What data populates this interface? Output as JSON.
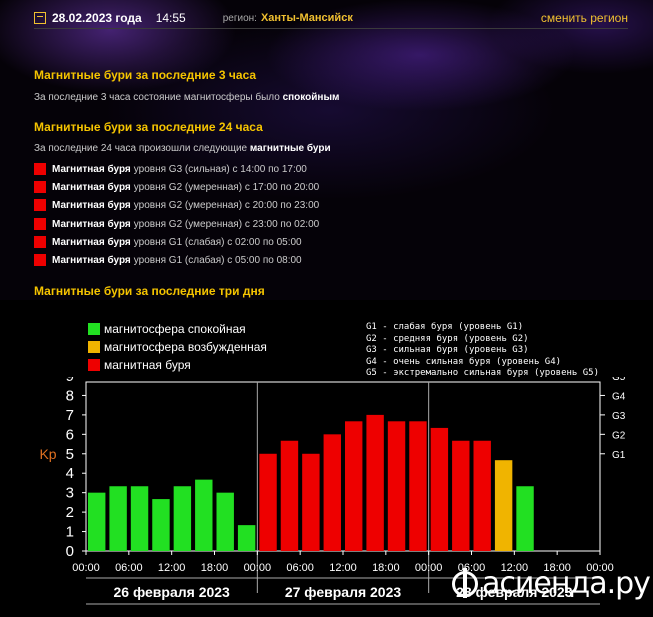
{
  "header": {
    "date": "28.02.2023 года",
    "time": "14:55",
    "region_label": "регион:",
    "region": "Ханты-Мансийск",
    "change_region": "сменить регион"
  },
  "sec3h": {
    "title": "Магнитные бури за последние 3 часа",
    "text_prefix": "За последние 3 часа состояние магнитосферы было",
    "text_bold": "спокойным"
  },
  "sec24h": {
    "title": "Магнитные бури за последние 24 часа",
    "text_prefix": "За последние 24 часа произошли следующие",
    "text_bold": "магнитные бури",
    "storms": [
      {
        "bold": "Магнитная буря",
        "rest": "уровня G3 (сильная) с 14:00 по 17:00"
      },
      {
        "bold": "Магнитная буря",
        "rest": "уровня G2 (умеренная) с 17:00 по 20:00"
      },
      {
        "bold": "Магнитная буря",
        "rest": "уровня G2 (умеренная) с 20:00 по 23:00"
      },
      {
        "bold": "Магнитная буря",
        "rest": "уровня G2 (умеренная) с 23:00 по 02:00"
      },
      {
        "bold": "Магнитная буря",
        "rest": "уровня G1 (слабая) с 02:00 по 05:00"
      },
      {
        "bold": "Магнитная буря",
        "rest": "уровня G1 (слабая) с 05:00 по 08:00"
      }
    ]
  },
  "sec3d": {
    "title": "Магнитные бури за последние три дня"
  },
  "legend": [
    {
      "label": "магнитосфера спокойная",
      "color": "#22e022"
    },
    {
      "label": "магнитосфера возбужденная",
      "color": "#f0b400"
    },
    {
      "label": "магнитная буря",
      "color": "#ee0000"
    }
  ],
  "glegend": [
    "G1 - слабая буря (уровень G1)",
    "G2 - средняя буря (уровень G2)",
    "G3 - сильная буря (уровень G3)",
    "G4 - очень сильная буря (уровень G4)",
    "G5 - экстремально сильная буря (уровень G5)"
  ],
  "watermark": "асиенда.ру",
  "chart_data": {
    "type": "bar",
    "ylabel": "Kp",
    "ylim": [
      0,
      9
    ],
    "yticks": [
      "0",
      "1",
      "2",
      "3",
      "4",
      "5",
      "6",
      "7",
      "8",
      "9"
    ],
    "right_ticks": [
      {
        "value": 5,
        "label": "G1"
      },
      {
        "value": 6,
        "label": "G2"
      },
      {
        "value": 7,
        "label": "G3"
      },
      {
        "value": 8,
        "label": "G4"
      },
      {
        "value": 9,
        "label": "G5"
      }
    ],
    "xtick_labels": [
      "00:00",
      "06:00",
      "12:00",
      "18:00",
      "00:00",
      "06:00",
      "12:00",
      "18:00",
      "00:00",
      "06:00",
      "12:00",
      "18:00",
      "00:00"
    ],
    "day_labels": [
      "26 февраля 2023",
      "27 февраля 2023",
      "28 февраля 2023"
    ],
    "grid": false,
    "values": [
      3.0,
      3.33,
      3.33,
      2.67,
      3.33,
      3.67,
      3.0,
      1.33,
      5.0,
      5.67,
      5.0,
      6.0,
      6.67,
      7.0,
      6.67,
      6.67,
      6.33,
      5.67,
      5.67,
      4.67,
      3.33,
      null,
      null,
      null
    ],
    "colors": [
      "#22e022",
      "#22e022",
      "#22e022",
      "#22e022",
      "#22e022",
      "#22e022",
      "#22e022",
      "#22e022",
      "#ee0000",
      "#ee0000",
      "#ee0000",
      "#ee0000",
      "#ee0000",
      "#ee0000",
      "#ee0000",
      "#ee0000",
      "#ee0000",
      "#ee0000",
      "#ee0000",
      "#f0b400",
      "#22e022",
      "",
      "",
      ""
    ]
  }
}
